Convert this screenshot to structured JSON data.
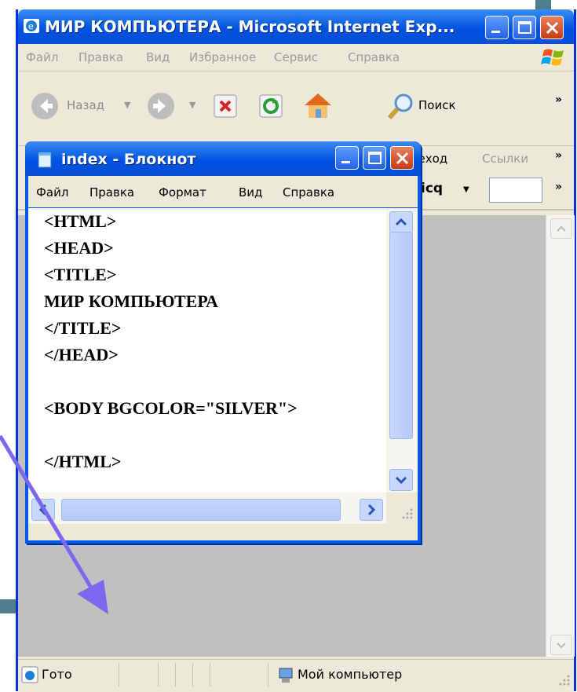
{
  "ie": {
    "title": "МИР КОМПЬЮТЕРА - Microsoft Internet Exp...",
    "menu": [
      "Файл",
      "Правка",
      "Вид",
      "Избранное",
      "Сервис",
      "Справка"
    ],
    "toolbar": {
      "back_label": "Назад",
      "search_label": "Поиск",
      "go_label": "реход",
      "links_label": "Ссылки",
      "icq_label": "icq"
    },
    "status": {
      "ready_text": "Гото",
      "zone_text": "Мой компьютер"
    }
  },
  "notepad": {
    "title": "index - Блокнот",
    "menu": [
      "Файл",
      "Правка",
      "Формат",
      "Вид",
      "Справка"
    ],
    "lines": [
      "<HTML>",
      "<HEAD>",
      "<TITLE>",
      "МИР КОМПЬЮТЕРА",
      "</TITLE>",
      "</HEAD>",
      "",
      "<BODY BGCOLOR=\"SILVER\">",
      "",
      "</HTML>"
    ]
  },
  "colors": {
    "title_blue": "#0a5fe0",
    "content_bg": "#c0c0c0",
    "arrow": "#7b68ee"
  }
}
